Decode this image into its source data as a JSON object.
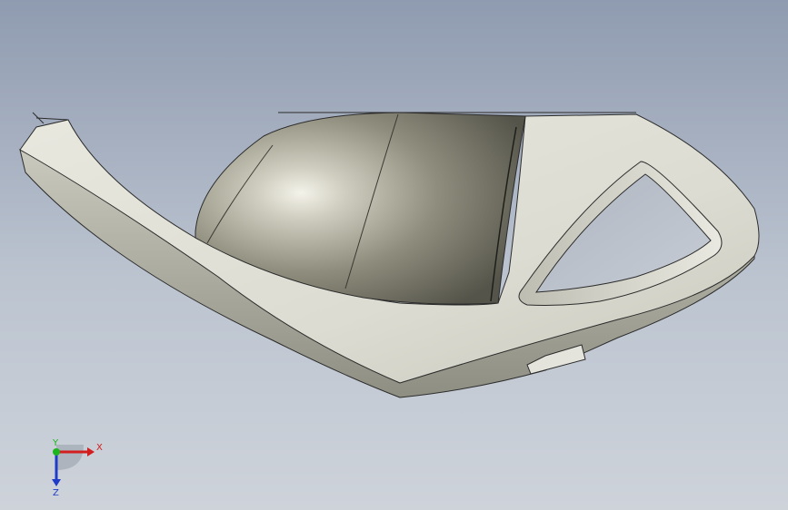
{
  "viewport": {
    "background_top": "#8f9bb0",
    "background_bottom": "#ced3da"
  },
  "model": {
    "body_color": "#dcdcd2",
    "lens_color": "#8c8a7a",
    "edge_color": "#2b2b2b"
  },
  "triad": {
    "x_label": "X",
    "y_label": "Y",
    "z_label": "Z",
    "x_color": "#d21e1e",
    "y_color": "#1eb41e",
    "z_color": "#1e3cc8"
  }
}
